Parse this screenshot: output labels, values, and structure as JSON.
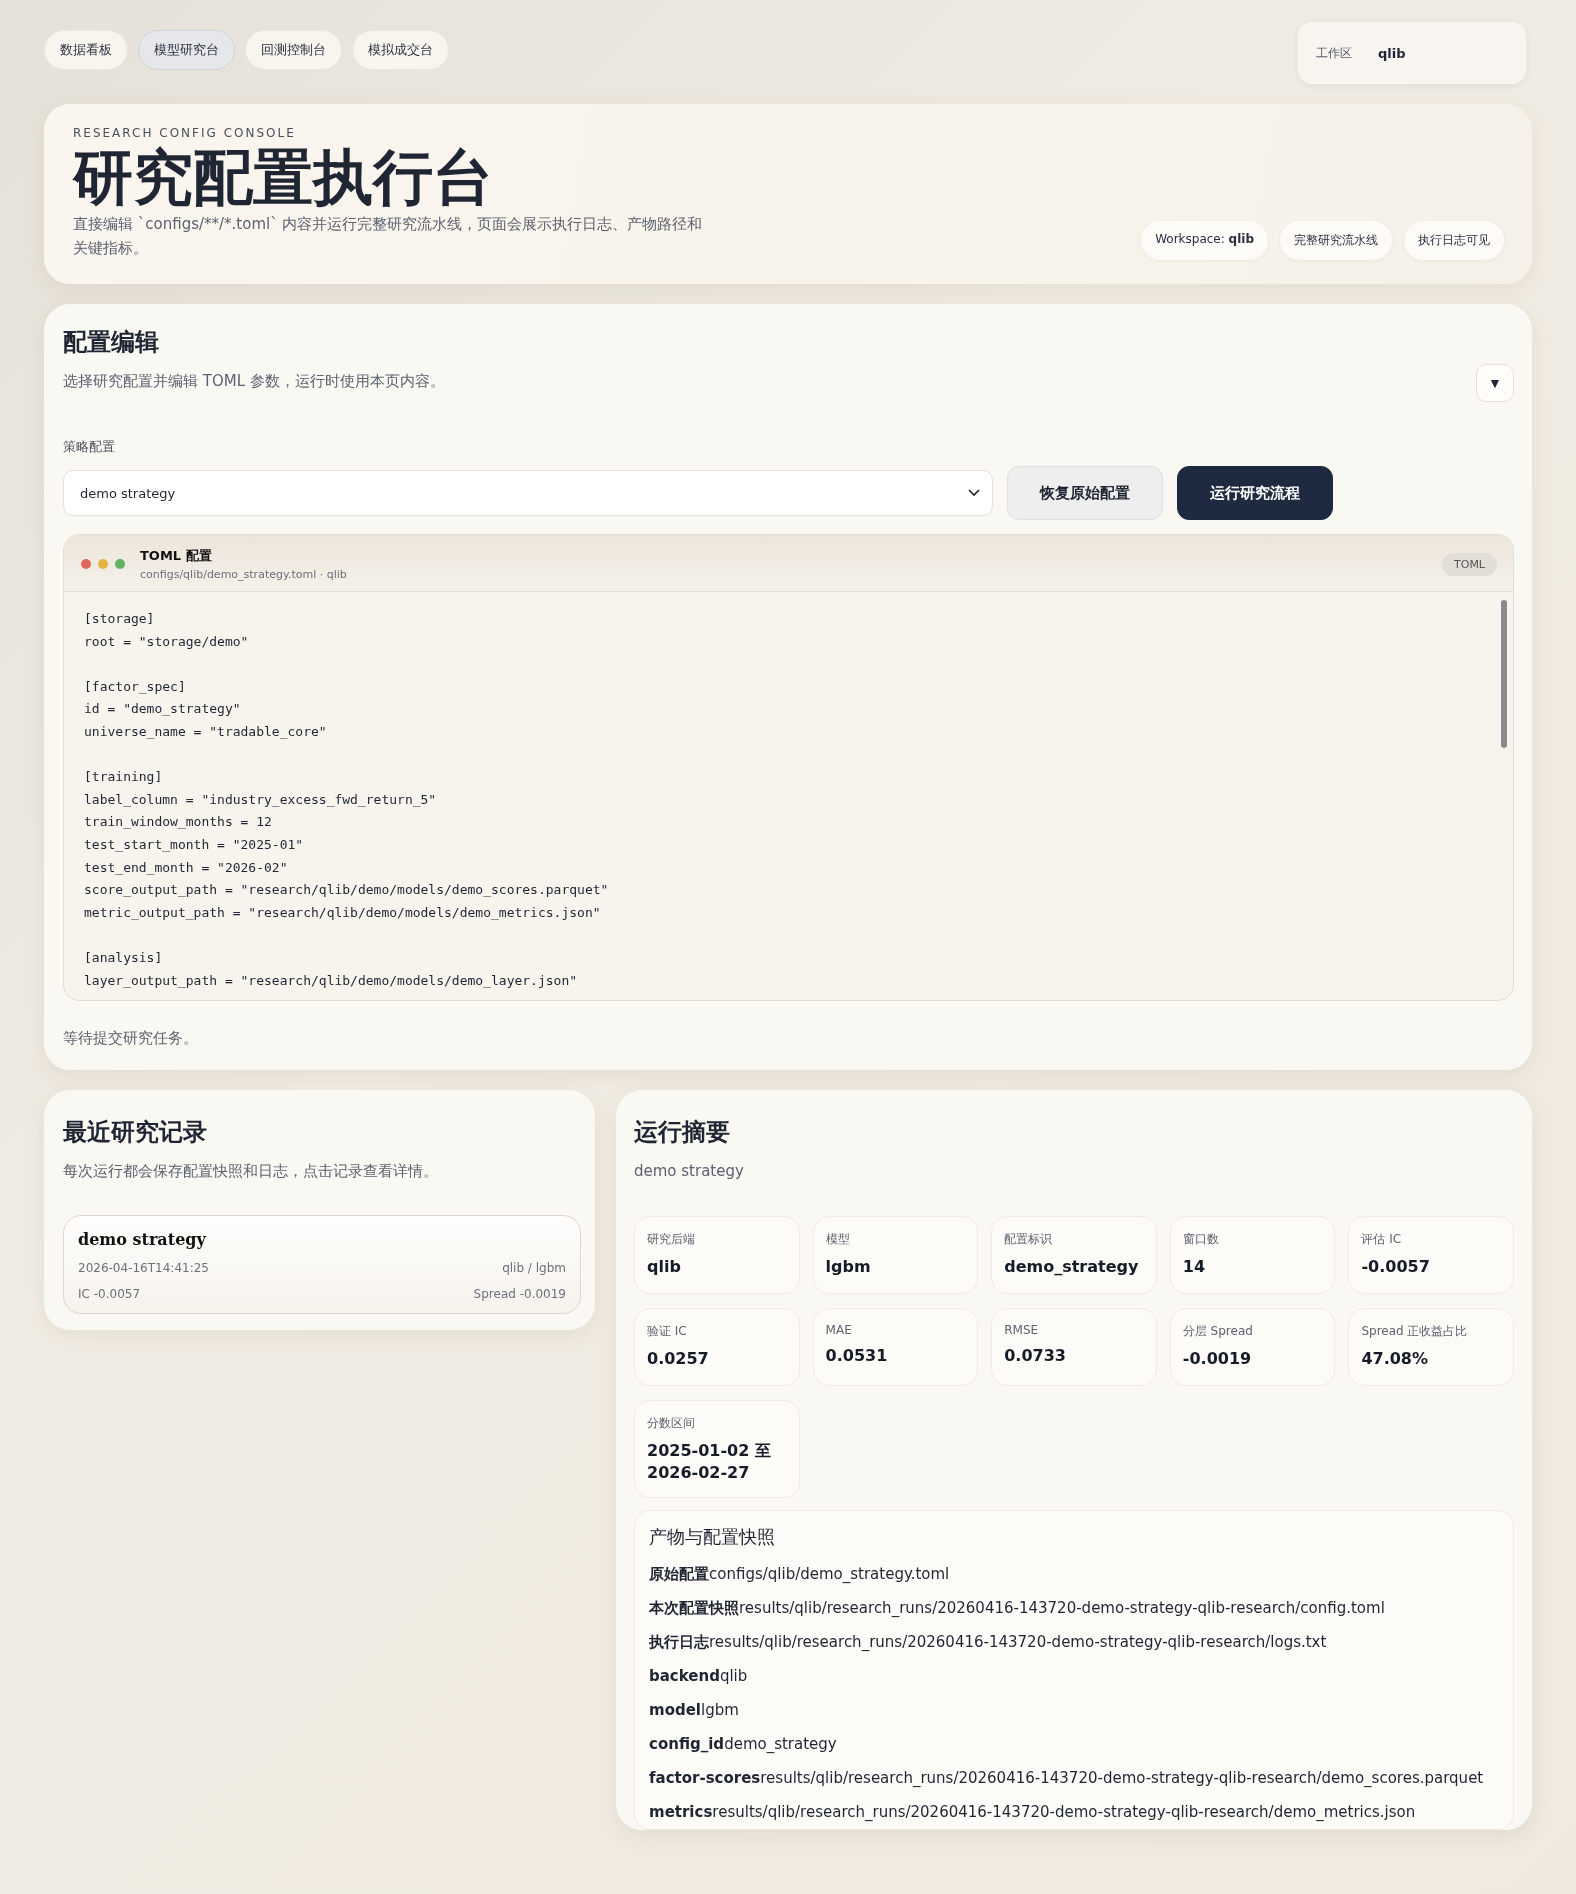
{
  "nav": {
    "tabs": [
      {
        "label": "数据看板",
        "selected": false
      },
      {
        "label": "模型研究台",
        "selected": true
      },
      {
        "label": "回测控制台",
        "selected": false
      },
      {
        "label": "模拟成交台",
        "selected": false
      }
    ],
    "workspace": {
      "label": "工作区",
      "value": "qlib"
    }
  },
  "hero": {
    "eyebrow": "RESEARCH CONFIG CONSOLE",
    "title": "研究配置执行台",
    "description": "直接编辑 `configs/**/*.toml` 内容并运行完整研究流水线，页面会展示执行日志、产物路径和关键指标。",
    "chips": [
      "Workspace: **qlib**",
      "完整研究流水线",
      "执行日志可见"
    ]
  },
  "editor": {
    "title": "配置编辑",
    "description": "选择研究配置并编辑 TOML 参数，运行时使用本页内容。",
    "collapse": "▼",
    "select_label": "策略配置",
    "select_value": "demo strategy",
    "buttons": [
      {
        "label": "恢复原始配置",
        "kind": "secondary"
      },
      {
        "label": "运行研究流程",
        "kind": "primary"
      }
    ],
    "file": {
      "title": "TOML 配置",
      "path": "configs/qlib/demo_strategy.toml · qlib",
      "badge": "TOML",
      "blocks": [
        [
          "[storage]",
          "root = \"storage/demo\""
        ],
        [
          "[factor_spec]",
          "id = \"demo_strategy\"",
          "universe_name = \"tradable_core\""
        ],
        [
          "[training]",
          "label_column = \"industry_excess_fwd_return_5\"",
          "train_window_months = 12",
          "test_start_month = \"2025-01\"",
          "test_end_month = \"2026-02\"",
          "score_output_path = \"research/qlib/demo/models/demo_scores.parquet\"",
          "metric_output_path = \"research/qlib/demo/models/demo_metrics.json\""
        ],
        [
          "[analysis]",
          "layer_output_path = \"research/qlib/demo/models/demo_layer.json\""
        ]
      ]
    },
    "status": "等待提交研究任务。"
  },
  "history": {
    "title": "最近研究记录",
    "description": "每次运行都会保存配置快照和日志，点击记录查看详情。",
    "records": [
      {
        "name": "demo strategy",
        "time": "2026-04-16T14:41:25",
        "engine": "qlib / lgbm",
        "ic": "IC -0.0057",
        "spread": "Spread -0.0019"
      }
    ]
  },
  "summary": {
    "title": "运行摘要",
    "subtitle": "demo strategy",
    "stats": [
      {
        "label": "研究后端",
        "value": "qlib"
      },
      {
        "label": "模型",
        "value": "lgbm"
      },
      {
        "label": "配置标识",
        "value": "demo_strategy"
      },
      {
        "label": "窗口数",
        "value": "14"
      },
      {
        "label": "评估 IC",
        "value": "-0.0057"
      },
      {
        "label": "验证 IC",
        "value": "0.0257"
      },
      {
        "label": "MAE",
        "value": "0.0531"
      },
      {
        "label": "RMSE",
        "value": "0.0733"
      },
      {
        "label": "分层 Spread",
        "value": "-0.0019"
      },
      {
        "label": "Spread 正收益占比",
        "value": "47.08%"
      },
      {
        "label": "分数区间",
        "value": "2025-01-02 至 2026-02-27"
      }
    ],
    "artifacts": {
      "title": "产物与配置快照",
      "items": [
        {
          "label": "原始配置",
          "value": "configs/qlib/demo_strategy.toml"
        },
        {
          "label": "本次配置快照",
          "value": "results/qlib/research_runs/20260416-143720-demo-strategy-qlib-research/config.toml"
        },
        {
          "label": "执行日志",
          "value": "results/qlib/research_runs/20260416-143720-demo-strategy-qlib-research/logs.txt"
        },
        {
          "label": "backend",
          "value": "qlib"
        },
        {
          "label": "model",
          "value": "lgbm"
        },
        {
          "label": "config_id",
          "value": "demo_strategy"
        },
        {
          "label": "factor-scores",
          "value": "results/qlib/research_runs/20260416-143720-demo-strategy-qlib-research/demo_scores.parquet"
        },
        {
          "label": "metrics",
          "value": "results/qlib/research_runs/20260416-143720-demo-strategy-qlib-research/demo_metrics.json"
        }
      ]
    }
  }
}
